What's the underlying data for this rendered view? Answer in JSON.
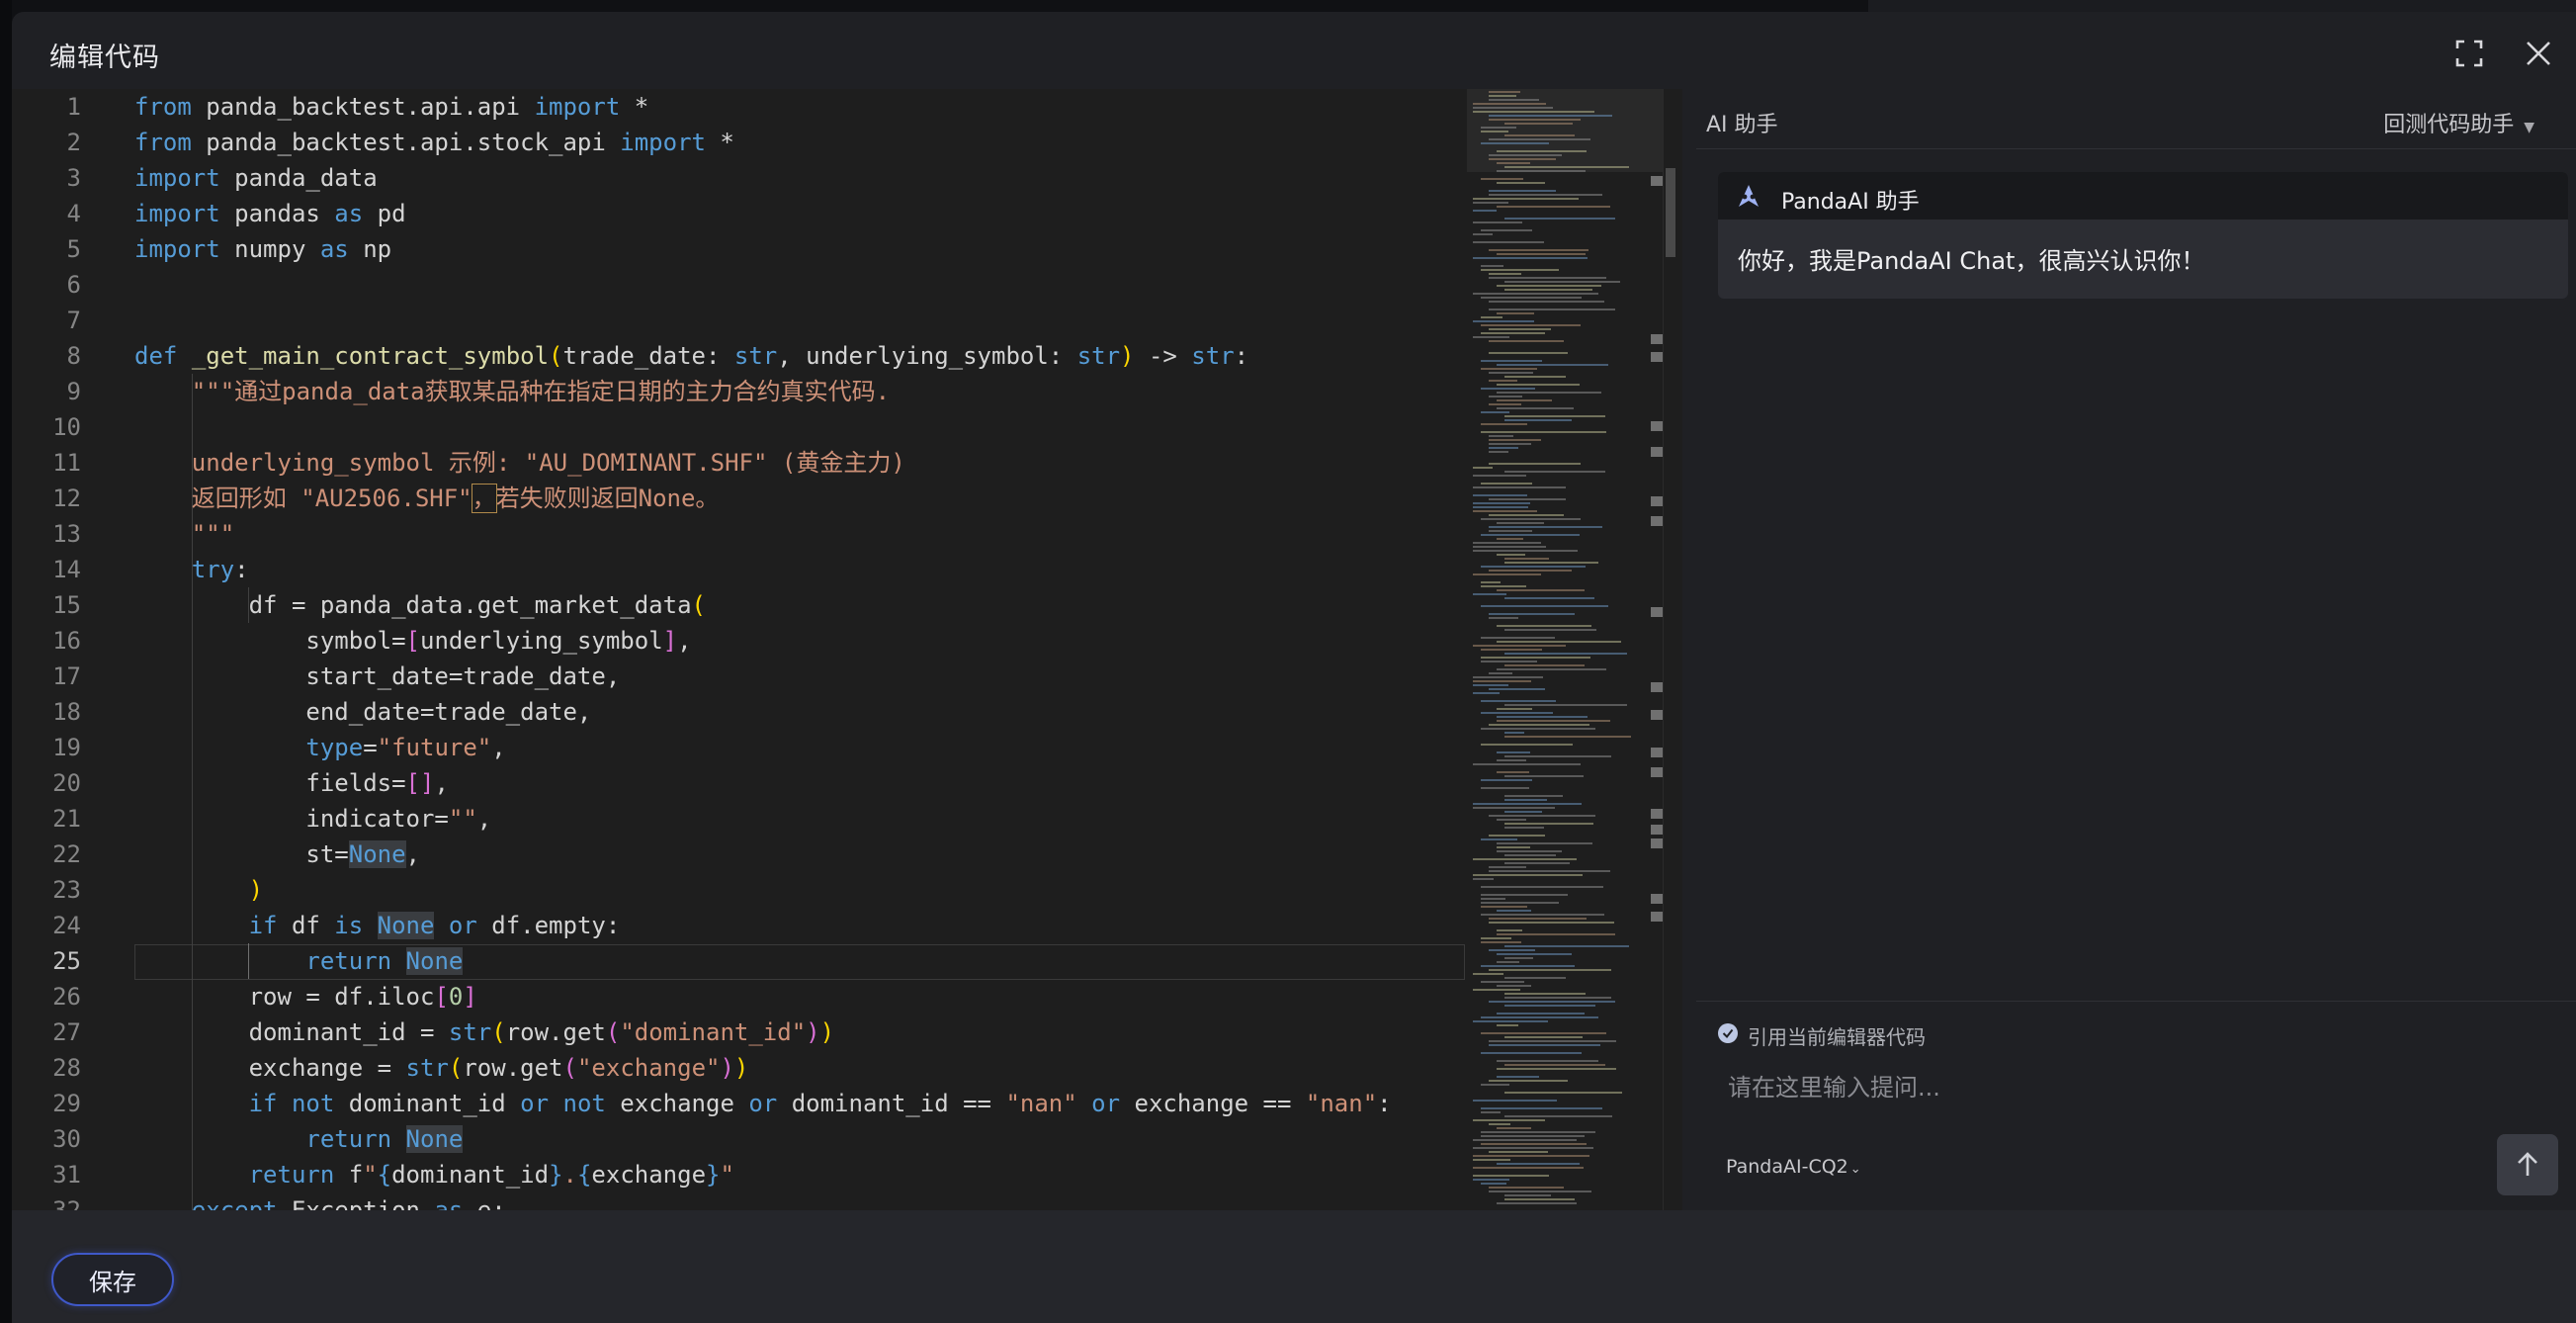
{
  "modal": {
    "title": "编辑代码"
  },
  "editor": {
    "active_line": 25,
    "line_count_visible": 32
  },
  "ai_panel": {
    "title": "AI 助手",
    "mode_label": "回测代码助手",
    "bot_name": "PandaAI 助手",
    "greeting": "你好，我是PandaAI Chat，很高兴认识你！",
    "reference_label": "引用当前编辑器代码",
    "reference_checked": true,
    "input_placeholder": "请在这里输入提问...",
    "model_label": "PandaAI-CQ2"
  },
  "footer": {
    "save_label": "保存"
  },
  "colors": {
    "accent": "#3f58c9",
    "keyword": "#569cd6",
    "string": "#ce9178",
    "function": "#dcdcaa",
    "number": "#b5cea8"
  },
  "icons": [
    "fullscreen-icon",
    "close-icon",
    "panda-bot-icon",
    "check-icon",
    "chevron-down-icon",
    "arrow-up-icon"
  ]
}
